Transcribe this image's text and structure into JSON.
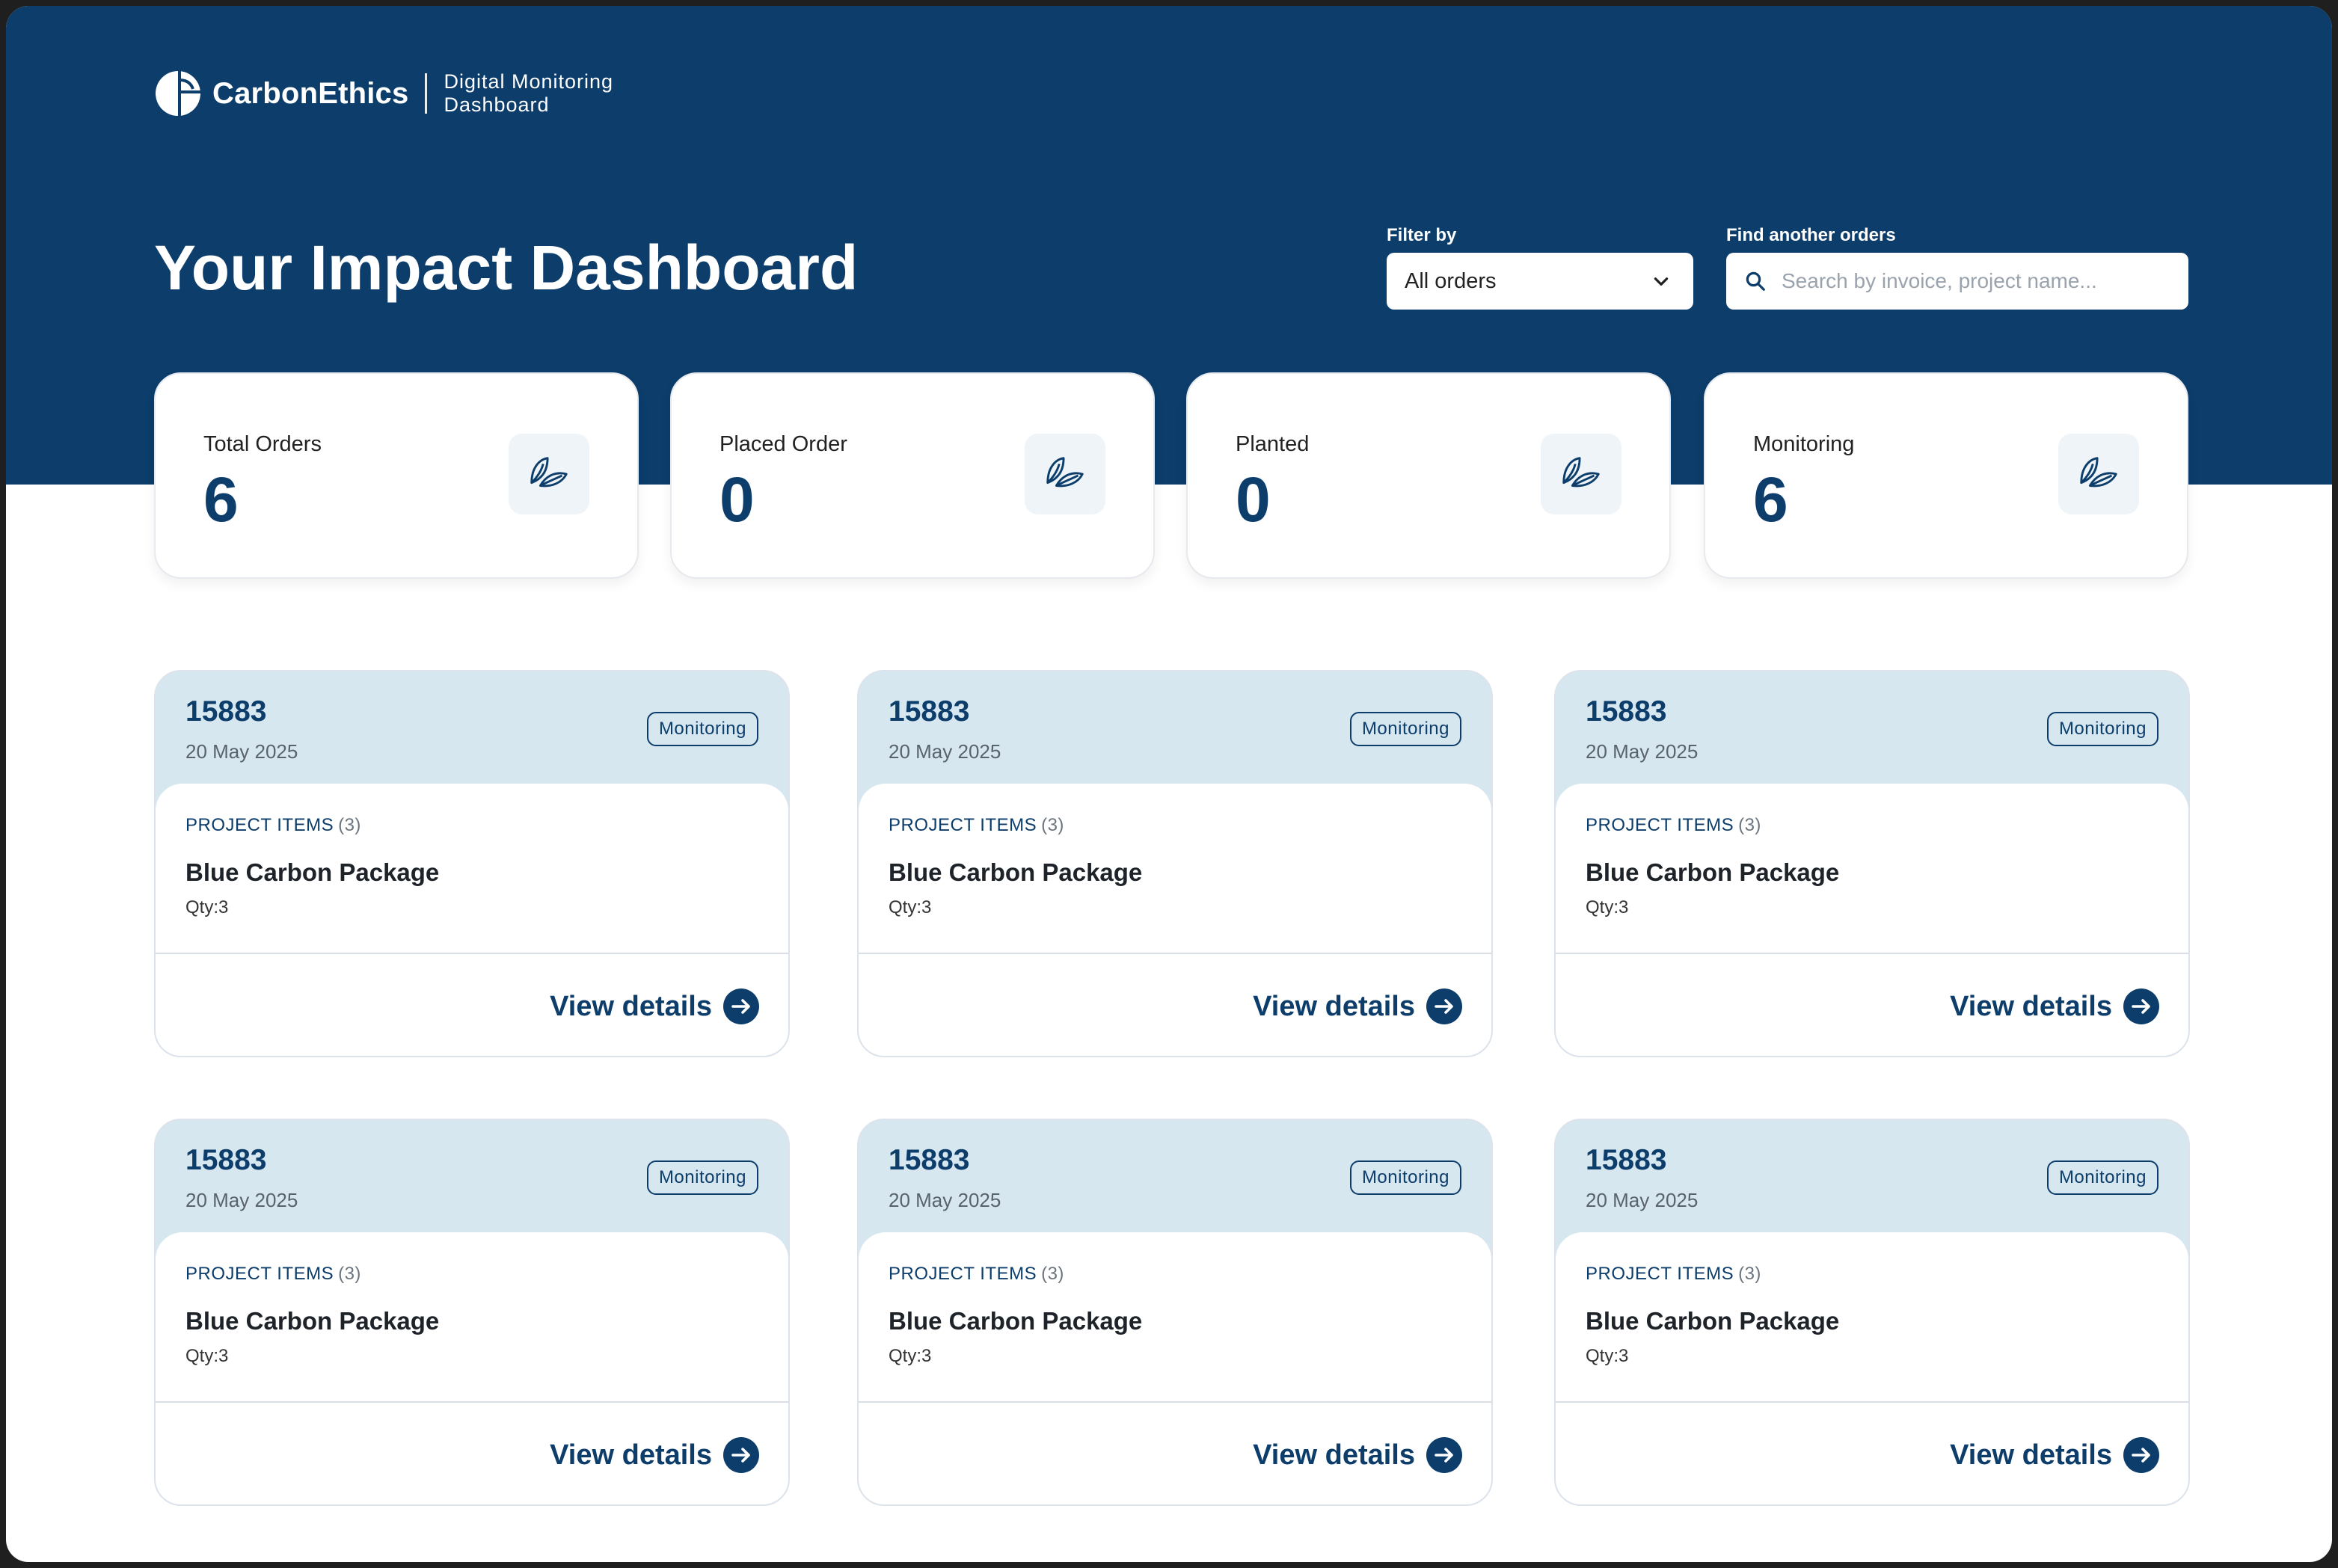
{
  "brand": {
    "name": "CarbonEthics",
    "subtitle_line1": "Digital Monitoring",
    "subtitle_line2": "Dashboard"
  },
  "page_title": "Your Impact Dashboard",
  "filter": {
    "label": "Filter by",
    "selected": "All orders"
  },
  "search": {
    "label": "Find another orders",
    "placeholder": "Search by invoice, project name..."
  },
  "stats": [
    {
      "label": "Total Orders",
      "value": "6",
      "icon": "leaf-icon"
    },
    {
      "label": "Placed Order",
      "value": "0",
      "icon": "leaf-icon"
    },
    {
      "label": "Planted",
      "value": "0",
      "icon": "leaf-icon"
    },
    {
      "label": "Monitoring",
      "value": "6",
      "icon": "leaf-icon"
    }
  ],
  "orders": [
    {
      "id": "15883",
      "date": "20 May 2025",
      "status": "Monitoring",
      "items_label": "PROJECT ITEMS",
      "items_count": "(3)",
      "package": "Blue Carbon Package",
      "qty": "Qty:3",
      "action": "View details"
    },
    {
      "id": "15883",
      "date": "20 May 2025",
      "status": "Monitoring",
      "items_label": "PROJECT ITEMS",
      "items_count": "(3)",
      "package": "Blue Carbon Package",
      "qty": "Qty:3",
      "action": "View details"
    },
    {
      "id": "15883",
      "date": "20 May 2025",
      "status": "Monitoring",
      "items_label": "PROJECT ITEMS",
      "items_count": "(3)",
      "package": "Blue Carbon Package",
      "qty": "Qty:3",
      "action": "View details"
    },
    {
      "id": "15883",
      "date": "20 May 2025",
      "status": "Monitoring",
      "items_label": "PROJECT ITEMS",
      "items_count": "(3)",
      "package": "Blue Carbon Package",
      "qty": "Qty:3",
      "action": "View details"
    },
    {
      "id": "15883",
      "date": "20 May 2025",
      "status": "Monitoring",
      "items_label": "PROJECT ITEMS",
      "items_count": "(3)",
      "package": "Blue Carbon Package",
      "qty": "Qty:3",
      "action": "View details"
    },
    {
      "id": "15883",
      "date": "20 May 2025",
      "status": "Monitoring",
      "items_label": "PROJECT ITEMS",
      "items_count": "(3)",
      "package": "Blue Carbon Package",
      "qty": "Qty:3",
      "action": "View details"
    }
  ],
  "colors": {
    "primary": "#0c3d6b",
    "header_tint": "#d6e7f0",
    "icon_bg": "#eef4f8"
  }
}
